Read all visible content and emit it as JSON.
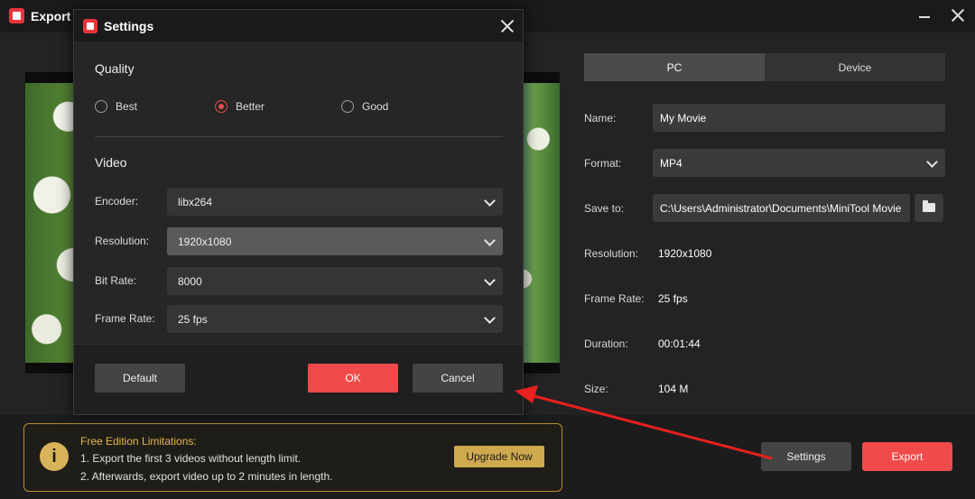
{
  "window": {
    "title": "Export"
  },
  "tabs": [
    {
      "label": "PC",
      "active": true
    },
    {
      "label": "Device",
      "active": false
    }
  ],
  "export_fields": {
    "name_label": "Name:",
    "name_value": "My Movie",
    "format_label": "Format:",
    "format_value": "MP4",
    "save_label": "Save to:",
    "save_value": "C:\\Users\\Administrator\\Documents\\MiniTool Movie",
    "resolution_label": "Resolution:",
    "resolution_value": "1920x1080",
    "framerate_label": "Frame Rate:",
    "framerate_value": "25 fps",
    "duration_label": "Duration:",
    "duration_value": "00:01:44",
    "size_label": "Size:",
    "size_value": "104 M"
  },
  "limitations": {
    "title": "Free Edition Limitations:",
    "line1": "1. Export the first 3 videos without length limit.",
    "line2": "2. Afterwards, export video up to 2 minutes in length.",
    "upgrade_label": "Upgrade Now"
  },
  "footer_buttons": {
    "settings_label": "Settings",
    "export_label": "Export"
  },
  "dialog": {
    "title": "Settings",
    "quality_title": "Quality",
    "quality_options": [
      {
        "label": "Best",
        "checked": false
      },
      {
        "label": "Better",
        "checked": true
      },
      {
        "label": "Good",
        "checked": false
      }
    ],
    "video_title": "Video",
    "encoder_label": "Encoder:",
    "encoder_value": "libx264",
    "resolution_label": "Resolution:",
    "resolution_value": "1920x1080",
    "bitrate_label": "Bit Rate:",
    "bitrate_value": "8000",
    "framerate_label": "Frame Rate:",
    "framerate_value": "25 fps",
    "default_label": "Default",
    "ok_label": "OK",
    "cancel_label": "Cancel"
  },
  "colors": {
    "accent": "#f04a4a",
    "gold": "#cfa94e",
    "annotation": "#e8201e"
  },
  "icons": {
    "app": "app-logo-icon",
    "minimize": "minimize-icon",
    "close": "close-icon",
    "folder": "folder-icon",
    "info": "info-icon",
    "chevron": "chevron-down-icon"
  }
}
